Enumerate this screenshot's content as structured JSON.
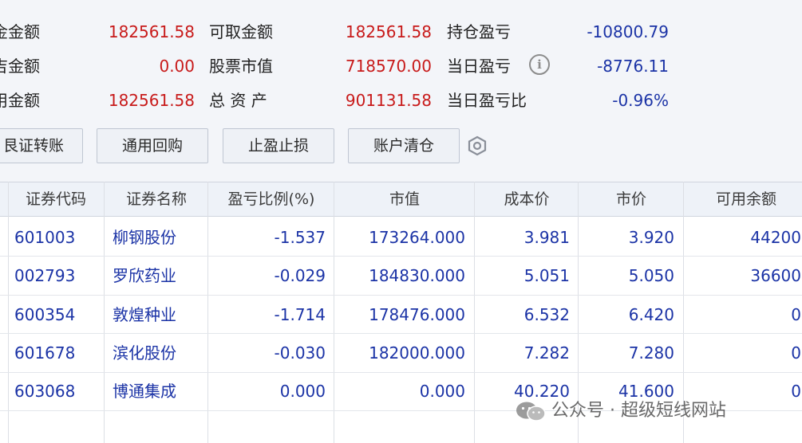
{
  "summary": {
    "rows": [
      {
        "l1": "金金额",
        "v1": "182561.58",
        "l2": "可取金额",
        "v2": "182561.58",
        "l3": "持仓盈亏",
        "v3": "-10800.79"
      },
      {
        "l1": "吉金额",
        "v1": "0.00",
        "l2": "股票市值",
        "v2": "718570.00",
        "l3": "当日盈亏",
        "v3": "-8776.11"
      },
      {
        "l1": "用金额",
        "v1": "182561.58",
        "l2": "总 资 产",
        "v2": "901131.58",
        "l3": "当日盈亏比",
        "v3": "-0.96%"
      }
    ],
    "info_icon": "info-icon"
  },
  "buttons": {
    "transfer": "艮证转账",
    "repo": "通用回购",
    "stop": "止盈止损",
    "clear": "账户清仓",
    "settings_icon": "hexagon-settings-icon"
  },
  "table": {
    "headers": [
      "证券代码",
      "证券名称",
      "盈亏比例(%)",
      "市值",
      "成本价",
      "市价",
      "可用余额"
    ],
    "rows": [
      {
        "code": "601003",
        "name": "柳钢股份",
        "pct": "-1.537",
        "mv": "173264.000",
        "cost": "3.981",
        "price": "3.920",
        "avail": "44200"
      },
      {
        "code": "002793",
        "name": "罗欣药业",
        "pct": "-0.029",
        "mv": "184830.000",
        "cost": "5.051",
        "price": "5.050",
        "avail": "36600"
      },
      {
        "code": "600354",
        "name": "敦煌种业",
        "pct": "-1.714",
        "mv": "178476.000",
        "cost": "6.532",
        "price": "6.420",
        "avail": "0"
      },
      {
        "code": "601678",
        "name": "滨化股份",
        "pct": "-0.030",
        "mv": "182000.000",
        "cost": "7.282",
        "price": "7.280",
        "avail": "0"
      },
      {
        "code": "603068",
        "name": "博通集成",
        "pct": "0.000",
        "mv": "0.000",
        "cost": "40.220",
        "price": "41.600",
        "avail": "0"
      }
    ]
  },
  "watermark": {
    "text": "公众号 · 超级短线网站",
    "icon": "wechat-icon"
  },
  "colors": {
    "positive_red": "#c81a1a",
    "link_blue": "#1b33a6",
    "header_bg": "#eef2f8"
  }
}
